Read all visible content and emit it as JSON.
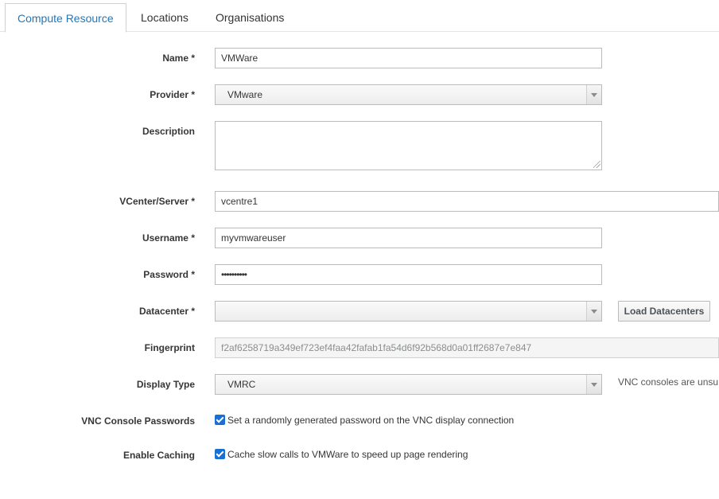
{
  "tabs": [
    {
      "label": "Compute Resource",
      "active": true
    },
    {
      "label": "Locations",
      "active": false
    },
    {
      "label": "Organisations",
      "active": false
    }
  ],
  "form": {
    "name": {
      "label": "Name *",
      "value": "VMWare"
    },
    "provider": {
      "label": "Provider *",
      "value": "VMware"
    },
    "description": {
      "label": "Description",
      "value": ""
    },
    "server": {
      "label": "VCenter/Server *",
      "value": "vcentre1"
    },
    "username": {
      "label": "Username *",
      "value": "myvmwareuser"
    },
    "password": {
      "label": "Password *",
      "value": "••••••••••"
    },
    "datacenter": {
      "label": "Datacenter *",
      "value": "",
      "button": "Load Datacenters"
    },
    "fingerprint": {
      "label": "Fingerprint",
      "value": "f2af6258719a349ef723ef4faa42fafab1fa54d6f92b568d0a01ff2687e7e847"
    },
    "display_type": {
      "label": "Display Type",
      "value": "VMRC",
      "help": "VNC consoles are unsu"
    },
    "vnc_passwords": {
      "label": "VNC Console Passwords",
      "checked": true,
      "text": "Set a randomly generated password on the VNC display connection"
    },
    "caching": {
      "label": "Enable Caching",
      "checked": true,
      "text": "Cache slow calls to VMWare to speed up page rendering"
    }
  },
  "colors": {
    "accent": "#1e78bd",
    "checkbox": "#1a6fd4"
  }
}
